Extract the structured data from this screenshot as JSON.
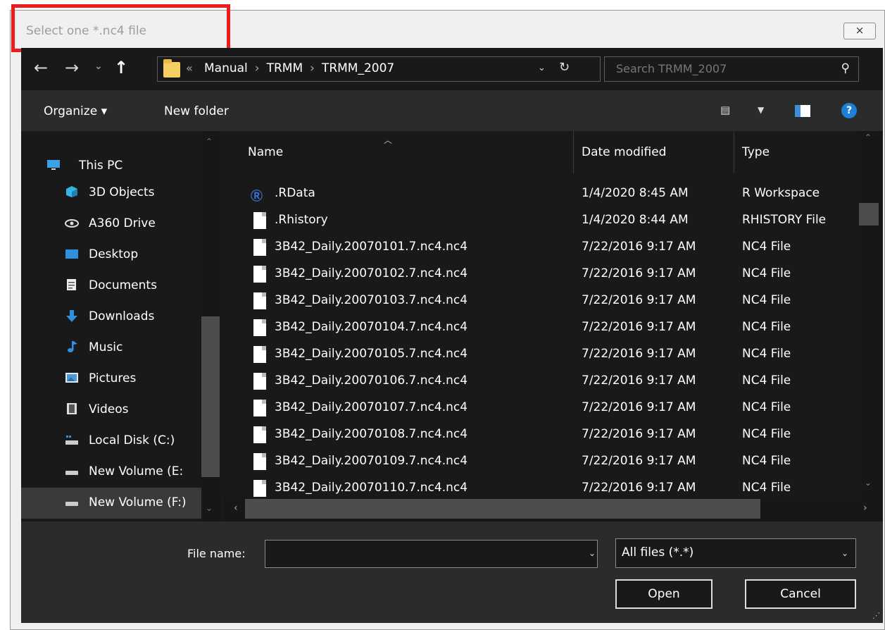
{
  "window": {
    "title": "Select one *.nc4 file",
    "close_label": "⨯"
  },
  "address_bar": {
    "crumbs": [
      "Manual",
      "TRMM",
      "TRMM_2007"
    ],
    "search_placeholder": "Search TRMM_2007"
  },
  "toolbar": {
    "organize_label": "Organize ▾",
    "new_folder_label": "New folder",
    "help_label": "?"
  },
  "nav_pane": {
    "items": [
      {
        "label": "This PC",
        "icon": "monitor-icon"
      },
      {
        "label": "3D Objects",
        "icon": "cube-icon"
      },
      {
        "label": "A360 Drive",
        "icon": "cloud-drive-icon"
      },
      {
        "label": "Desktop",
        "icon": "desktop-icon"
      },
      {
        "label": "Documents",
        "icon": "documents-icon"
      },
      {
        "label": "Downloads",
        "icon": "download-arrow-icon"
      },
      {
        "label": "Music",
        "icon": "music-note-icon"
      },
      {
        "label": "Pictures",
        "icon": "picture-icon"
      },
      {
        "label": "Videos",
        "icon": "film-icon"
      },
      {
        "label": "Local Disk (C:)",
        "icon": "disk-icon"
      },
      {
        "label": "New Volume (E:",
        "icon": "drive-icon"
      },
      {
        "label": "New Volume (F:)",
        "icon": "drive-icon"
      }
    ],
    "selected_index": 11
  },
  "file_list": {
    "columns": {
      "name": "Name",
      "date": "Date modified",
      "type": "Type"
    },
    "rows": [
      {
        "name": ".RData",
        "date": "1/4/2020 8:45 AM",
        "type": "R Workspace",
        "icon": "r-logo-icon"
      },
      {
        "name": ".Rhistory",
        "date": "1/4/2020 8:44 AM",
        "type": "RHISTORY File",
        "icon": "file-icon"
      },
      {
        "name": "3B42_Daily.20070101.7.nc4.nc4",
        "date": "7/22/2016 9:17 AM",
        "type": "NC4 File",
        "icon": "file-icon"
      },
      {
        "name": "3B42_Daily.20070102.7.nc4.nc4",
        "date": "7/22/2016 9:17 AM",
        "type": "NC4 File",
        "icon": "file-icon"
      },
      {
        "name": "3B42_Daily.20070103.7.nc4.nc4",
        "date": "7/22/2016 9:17 AM",
        "type": "NC4 File",
        "icon": "file-icon"
      },
      {
        "name": "3B42_Daily.20070104.7.nc4.nc4",
        "date": "7/22/2016 9:17 AM",
        "type": "NC4 File",
        "icon": "file-icon"
      },
      {
        "name": "3B42_Daily.20070105.7.nc4.nc4",
        "date": "7/22/2016 9:17 AM",
        "type": "NC4 File",
        "icon": "file-icon"
      },
      {
        "name": "3B42_Daily.20070106.7.nc4.nc4",
        "date": "7/22/2016 9:17 AM",
        "type": "NC4 File",
        "icon": "file-icon"
      },
      {
        "name": "3B42_Daily.20070107.7.nc4.nc4",
        "date": "7/22/2016 9:17 AM",
        "type": "NC4 File",
        "icon": "file-icon"
      },
      {
        "name": "3B42_Daily.20070108.7.nc4.nc4",
        "date": "7/22/2016 9:17 AM",
        "type": "NC4 File",
        "icon": "file-icon"
      },
      {
        "name": "3B42_Daily.20070109.7.nc4.nc4",
        "date": "7/22/2016 9:17 AM",
        "type": "NC4 File",
        "icon": "file-icon"
      },
      {
        "name": "3B42_Daily.20070110.7.nc4.nc4",
        "date": "7/22/2016 9:17 AM",
        "type": "NC4 File",
        "icon": "file-icon"
      }
    ]
  },
  "footer": {
    "file_name_label": "File name:",
    "file_name_value": "",
    "filter_value": "All files (*.*)",
    "open_label": "Open",
    "cancel_label": "Cancel"
  },
  "colors": {
    "annotation": "#ee1c1c",
    "background": "#191919",
    "bar": "#2b2b2b"
  }
}
